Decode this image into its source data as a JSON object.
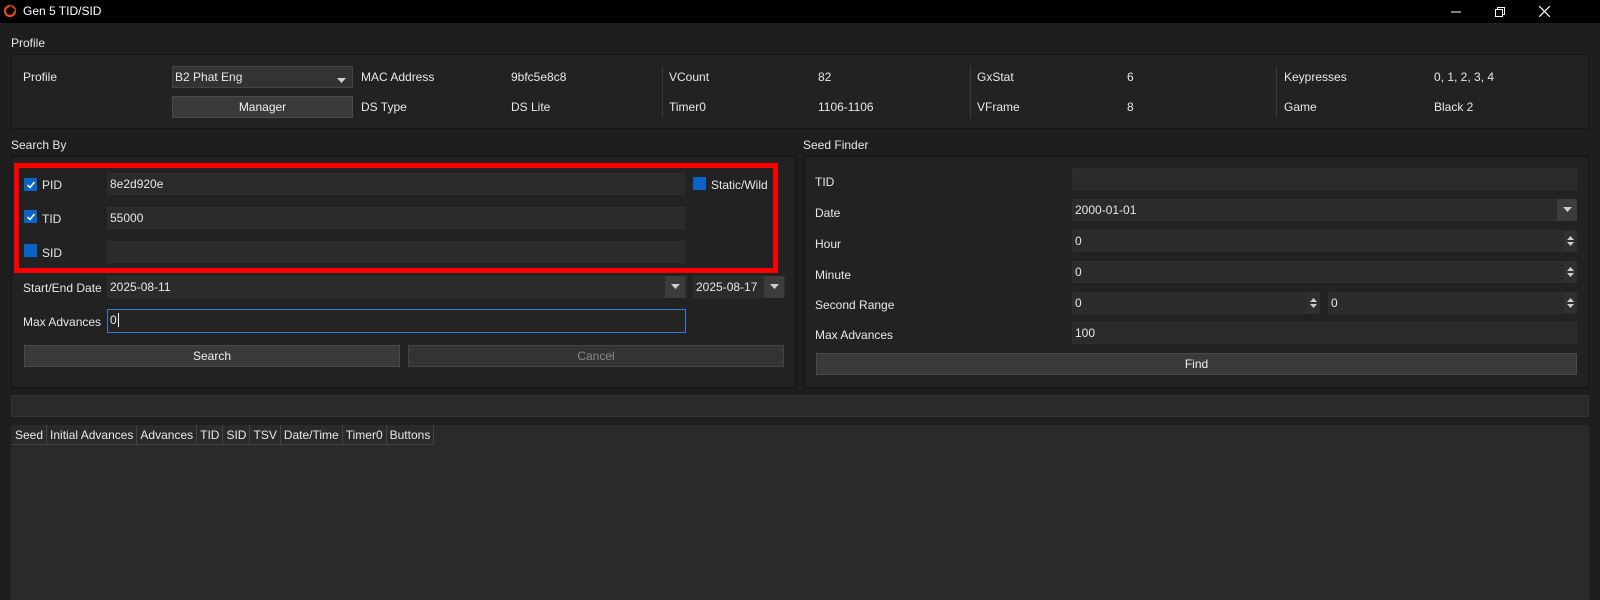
{
  "window": {
    "title": "Gen 5 TID/SID",
    "icon": "app-ring-icon",
    "controls": [
      "minimize-icon",
      "restore-icon",
      "close-icon"
    ]
  },
  "profile_group": {
    "title": "Profile",
    "profile_label": "Profile",
    "profile_value": "B2 Phat Eng",
    "manager_label": "Manager",
    "info": [
      {
        "label": "MAC Address",
        "value": "9bfc5e8c8"
      },
      {
        "label": "DS Type",
        "value": "DS Lite"
      },
      {
        "label": "VCount",
        "value": "82"
      },
      {
        "label": "Timer0",
        "value": "1106-1106"
      },
      {
        "label": "GxStat",
        "value": "6"
      },
      {
        "label": "VFrame",
        "value": "8"
      },
      {
        "label": "Keypresses",
        "value": "0, 1, 2, 3, 4"
      },
      {
        "label": "Game",
        "value": "Black 2"
      }
    ]
  },
  "search_by": {
    "title": "Search By",
    "pid": {
      "label": "PID",
      "checked": true,
      "value": "8e2d920e"
    },
    "tid": {
      "label": "TID",
      "checked": true,
      "value": "55000"
    },
    "sid": {
      "label": "SID",
      "checked": true,
      "value": ""
    },
    "static_wild": {
      "label": "Static/Wild",
      "checked": true
    },
    "date_label": "Start/End Date",
    "start_date": "2025-08-11",
    "end_date": "2025-08-17",
    "max_advances_label": "Max Advances",
    "max_advances": "0",
    "search_label": "Search",
    "cancel_label": "Cancel"
  },
  "seed_finder": {
    "title": "Seed Finder",
    "tid_label": "TID",
    "tid_value": "",
    "date_label": "Date",
    "date_value": "2000-01-01",
    "hour_label": "Hour",
    "hour_value": "0",
    "minute_label": "Minute",
    "minute_value": "0",
    "second_range_label": "Second Range",
    "second_min": "0",
    "second_max": "0",
    "max_advances_label": "Max Advances",
    "max_advances": "100",
    "find_label": "Find"
  },
  "results_table": {
    "columns": [
      "Seed",
      "Initial Advances",
      "Advances",
      "TID",
      "SID",
      "TSV",
      "Date/Time",
      "Timer0",
      "Buttons"
    ]
  },
  "colors": {
    "accent": "#0a64c8",
    "highlight": "#ff0000",
    "background": "#1e1e1e"
  }
}
